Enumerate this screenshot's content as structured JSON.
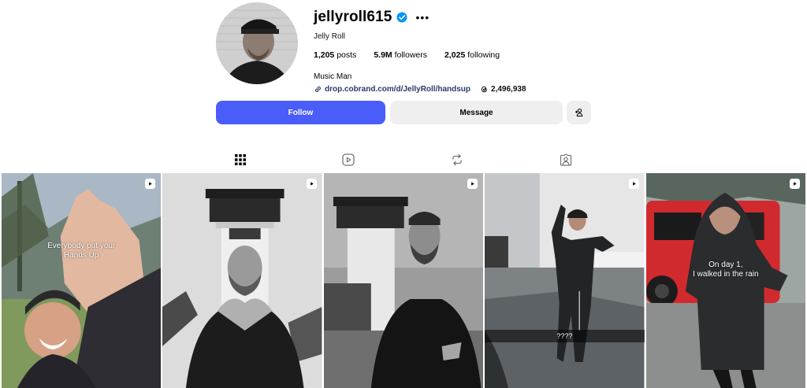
{
  "profile": {
    "username": "jellyroll615",
    "more_label": "•••",
    "full_name": "Jelly Roll",
    "stats": {
      "posts_count": "1,205",
      "posts_label": "posts",
      "followers_count": "5.9M",
      "followers_label": "followers",
      "following_count": "2,025",
      "following_label": "following"
    },
    "bio": "Music Man",
    "link_text": "drop.cobrand.com/d/JellyRoll/handsup",
    "threads_count": "2,496,938"
  },
  "actions": {
    "follow_label": "Follow",
    "message_label": "Message",
    "suggest_icon": "add-person-icon"
  },
  "tabs": [
    {
      "icon": "grid-icon",
      "active": true
    },
    {
      "icon": "reels-icon",
      "active": false
    },
    {
      "icon": "reposts-icon",
      "active": false
    },
    {
      "icon": "tagged-icon",
      "active": false
    }
  ],
  "posts": [
    {
      "type": "reel",
      "caption": "Everybody put your\nHands Up"
    },
    {
      "type": "reel",
      "caption": ""
    },
    {
      "type": "reel",
      "caption": ""
    },
    {
      "type": "reel",
      "caption": "????"
    },
    {
      "type": "reel",
      "caption": "On day 1,\nI walked in the rain"
    }
  ],
  "colors": {
    "accent": "#4a5df9",
    "verified": "#0095f6",
    "link": "#2b3a67"
  }
}
